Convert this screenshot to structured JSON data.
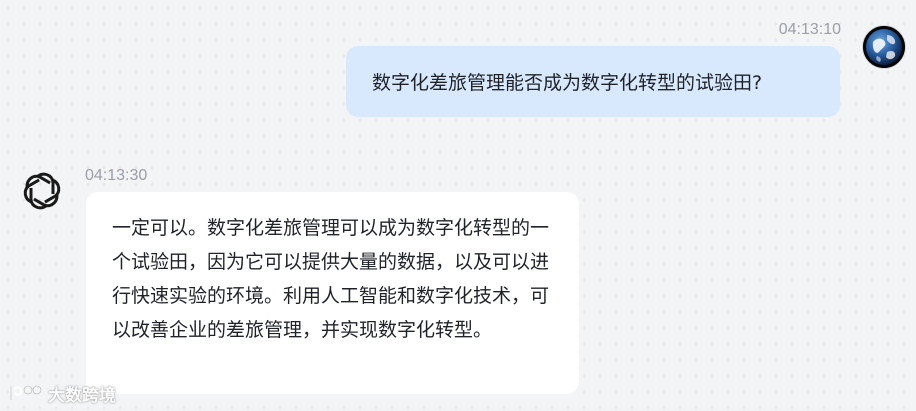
{
  "messages": {
    "user": {
      "timestamp": "04:13:10",
      "text": "数字化差旅管理能否成为数字化转型的试验田?"
    },
    "assistant": {
      "timestamp": "04:13:30",
      "text": "一定可以。数字化差旅管理可以成为数字化转型的一个试验田，因为它可以提供大量的数据，以及可以进行快速实验的环境。利用人工智能和数字化技术，可以改善企业的差旅管理，并实现数字化转型。"
    }
  },
  "watermark": {
    "text": "大数跨境"
  },
  "icons": {
    "user_avatar": "earth-globe-icon",
    "assistant_avatar": "openai-logo-icon"
  },
  "colors": {
    "user_bubble": "#d8e8fd",
    "assistant_bubble": "#ffffff",
    "background": "#f3f4f6"
  }
}
